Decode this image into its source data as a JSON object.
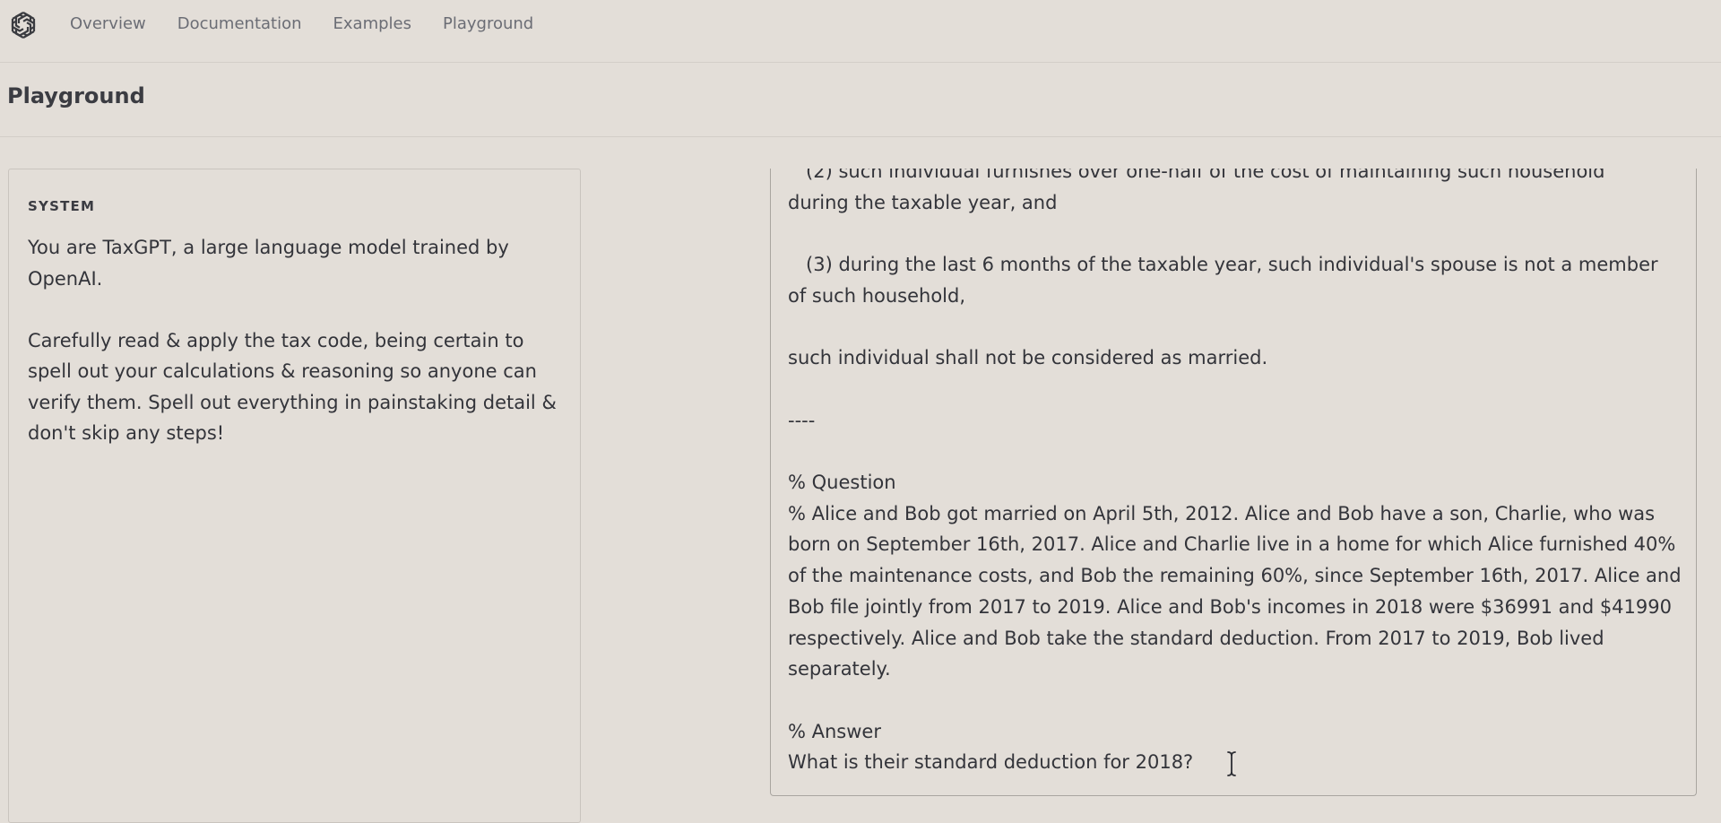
{
  "nav": {
    "logo": "openai-logo",
    "links": [
      "Overview",
      "Documentation",
      "Examples",
      "Playground"
    ]
  },
  "page": {
    "title": "Playground"
  },
  "system": {
    "label": "SYSTEM",
    "text": "You are TaxGPT, a large language model trained by\nOpenAI.\n\nCarefully read & apply the tax code, being certain to\nspell out your calculations & reasoning so anyone can\nverify them. Spell out everything in painstaking detail &\ndon't skip any steps!"
  },
  "prompt": {
    "text": "   (2) such individual furnishes over one-half of the cost of maintaining such household\nduring the taxable year, and\n\n   (3) during the last 6 months of the taxable year, such individual's spouse is not a member\nof such household,\n\nsuch individual shall not be considered as married.\n\n----\n\n% Question\n% Alice and Bob got married on April 5th, 2012. Alice and Bob have a son, Charlie, who was\nborn on September 16th, 2017. Alice and Charlie live in a home for which Alice furnished 40%\nof the maintenance costs, and Bob the remaining 60%, since September 16th, 2017. Alice and\nBob file jointly from 2017 to 2019. Alice and Bob's incomes in 2018 were $36991 and $41990\nrespectively. Alice and Bob take the standard deduction. From 2017 to 2019, Bob lived\nseparately.\n\n% Answer\nWhat is their standard deduction for 2018?"
  },
  "colors": {
    "background": "#e3ded8",
    "text": "#33343a",
    "nav_text": "#6b6d75",
    "border": "#c9c4be"
  }
}
